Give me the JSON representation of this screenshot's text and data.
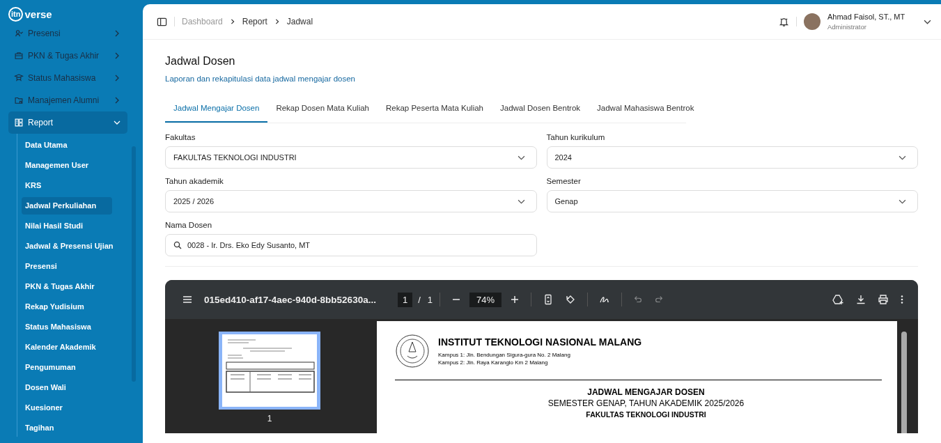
{
  "sidebar": {
    "logo": {
      "mark": "itn",
      "word": "verse"
    },
    "menu": [
      {
        "label": "Presensi",
        "expanded": false
      },
      {
        "label": "PKN & Tugas Akhir",
        "expanded": false
      },
      {
        "label": "Status Mahasiswa",
        "expanded": false
      },
      {
        "label": "Manajemen Alumni",
        "expanded": false
      },
      {
        "label": "Report",
        "expanded": true,
        "children": [
          {
            "label": "Data Utama",
            "selected": false
          },
          {
            "label": "Managemen User",
            "selected": false
          },
          {
            "label": "KRS",
            "selected": false
          },
          {
            "label": "Jadwal Perkuliahan",
            "selected": true
          },
          {
            "label": "Nilai Hasil Studi",
            "selected": false
          },
          {
            "label": "Jadwal & Presensi Ujian",
            "selected": false
          },
          {
            "label": "Presensi",
            "selected": false
          },
          {
            "label": "PKN & Tugas Akhir",
            "selected": false
          },
          {
            "label": "Rekap Yudisium",
            "selected": false
          },
          {
            "label": "Status Mahasiswa",
            "selected": false
          },
          {
            "label": "Kalender Akademik",
            "selected": false
          },
          {
            "label": "Pengumuman",
            "selected": false
          },
          {
            "label": "Dosen Wali",
            "selected": false
          },
          {
            "label": "Kuesioner",
            "selected": false
          },
          {
            "label": "Tagihan",
            "selected": false
          }
        ]
      }
    ]
  },
  "header": {
    "breadcrumbs": [
      "Dashboard",
      "Report",
      "Jadwal"
    ],
    "user": {
      "name": "Ahmad Faisol, ST., MT",
      "role": "Administrator"
    }
  },
  "page": {
    "title": "Jadwal Dosen",
    "subtitle": "Laporan dan rekapitulasi data jadwal mengajar dosen",
    "tabs": [
      {
        "label": "Jadwal Mengajar Dosen",
        "selected": true
      },
      {
        "label": "Rekap Dosen Mata Kuliah",
        "selected": false
      },
      {
        "label": "Rekap Peserta Mata Kuliah",
        "selected": false
      },
      {
        "label": "Jadwal Dosen Bentrok",
        "selected": false
      },
      {
        "label": "Jadwal Mahasiswa Bentrok",
        "selected": false
      }
    ],
    "fields": [
      {
        "kind": "select",
        "label": "Fakultas",
        "value": "FAKULTAS TEKNOLOGI INDUSTRI"
      },
      {
        "kind": "select",
        "label": "Tahun kurikulum",
        "value": "2024"
      },
      {
        "kind": "select",
        "label": "Tahun akademik",
        "value": "2025 / 2026"
      },
      {
        "kind": "select",
        "label": "Semester",
        "value": "Genap"
      },
      {
        "kind": "search",
        "label": "Nama Dosen",
        "value": "0028 - Ir. Drs. Eko Edy Susanto, MT"
      }
    ]
  },
  "pdf_viewer": {
    "filename": "015ed410-af17-4aec-940d-8bb52630a...",
    "page": "1",
    "page_separator": "/",
    "page_total": "1",
    "zoom": "74%",
    "undo_disabled": true,
    "redo_disabled": true,
    "thumbnail_label": "1",
    "document": {
      "institution": "INSTITUT TEKNOLOGI NASIONAL MALANG",
      "addresses": [
        "Kampus 1: Jln. Bendungan Sigura-gura No. 2 Malang",
        "Kampus 2: Jln. Raya Karanglo Km 2 Malang"
      ],
      "title": "JADWAL MENGAJAR DOSEN",
      "subtitle": "SEMESTER GENAP, TAHUN AKADEMIK 2025/2026",
      "faculty": "FAKULTAS TEKNOLOGI INDUSTRI"
    }
  }
}
